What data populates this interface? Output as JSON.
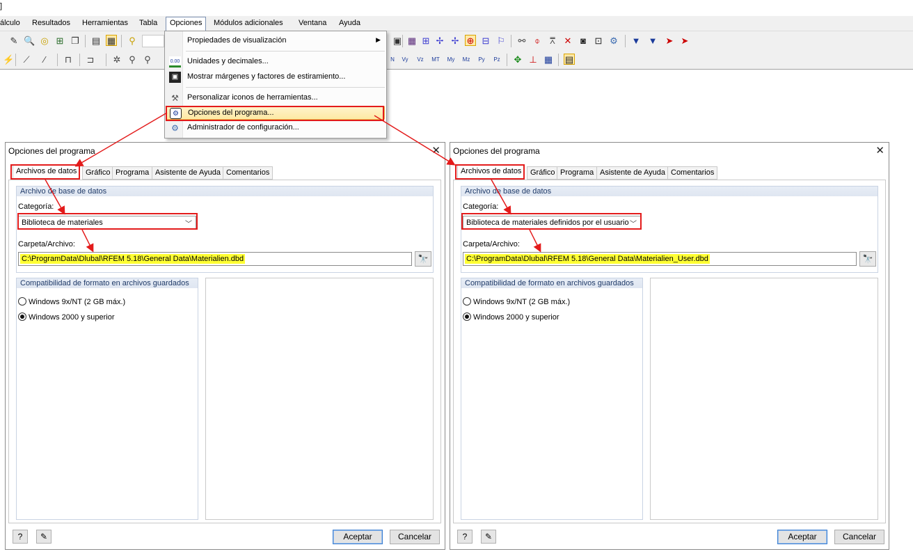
{
  "title_stub": "]",
  "menubar": {
    "items": [
      {
        "label": "álculo"
      },
      {
        "label": "Resultados"
      },
      {
        "label": "Herramientas"
      },
      {
        "label": "Tabla"
      },
      {
        "label": "Opciones"
      },
      {
        "label": "Módulos adicionales"
      },
      {
        "label": "Ventana"
      },
      {
        "label": "Ayuda"
      }
    ]
  },
  "toolbar2_labels": [
    "N",
    "Vy",
    "Vz",
    "MT",
    "My",
    "Mz",
    "Py",
    "Pz"
  ],
  "dropdown": {
    "items": [
      {
        "label": "Propiedades de visualización",
        "icon": "submenu-arrow"
      },
      {
        "label": "Unidades y decimales...",
        "icon": "units-icon",
        "icon_text": "0.00"
      },
      {
        "label": "Mostrar márgenes y factores de estiramiento...",
        "icon": "margins-icon"
      },
      {
        "label": "Personalizar iconos de herramientas...",
        "icon": "customize-icon"
      },
      {
        "label": "Opciones del programa...",
        "icon": "program-options-icon"
      },
      {
        "label": "Administrador de configuración...",
        "icon": "config-manager-icon"
      }
    ]
  },
  "dialogs": [
    {
      "title": "Opciones del programa",
      "tabs": [
        "Archivos de datos",
        "Gráfico",
        "Programa",
        "Asistente de Ayuda",
        "Comentarios"
      ],
      "active_tab": "Archivos de datos",
      "db_group_title": "Archivo de base de datos",
      "category_label": "Categoría:",
      "category_value": "Biblioteca de materiales",
      "folder_label": "Carpeta/Archivo:",
      "folder_value": "C:\\ProgramData\\Dlubal\\RFEM 5.18\\General Data\\Materialien.dbd",
      "compat_title": "Compatibilidad de formato en archivos guardados",
      "radio1": "Windows 9x/NT (2 GB máx.)",
      "radio2": "Windows 2000 y superior",
      "selected_radio": 2,
      "ok": "Aceptar",
      "cancel": "Cancelar"
    },
    {
      "title": "Opciones del programa",
      "tabs": [
        "Archivos de datos",
        "Gráfico",
        "Programa",
        "Asistente de Ayuda",
        "Comentarios"
      ],
      "active_tab": "Archivos de datos",
      "db_group_title": "Archivo de base de datos",
      "category_label": "Categoría:",
      "category_value": "Biblioteca de materiales definidos por el usuario",
      "folder_label": "Carpeta/Archivo:",
      "folder_value": "C:\\ProgramData\\Dlubal\\RFEM 5.18\\General Data\\Materialien_User.dbd",
      "compat_title": "Compatibilidad de formato en archivos guardados",
      "radio1": "Windows 9x/NT (2 GB máx.)",
      "radio2": "Windows 2000 y superior",
      "selected_radio": 2,
      "ok": "Aceptar",
      "cancel": "Cancelar"
    }
  ],
  "colors": {
    "highlight_box": "#e31b1b",
    "path_highlight": "#ffff33",
    "menu_hover": "#fde9a4"
  }
}
